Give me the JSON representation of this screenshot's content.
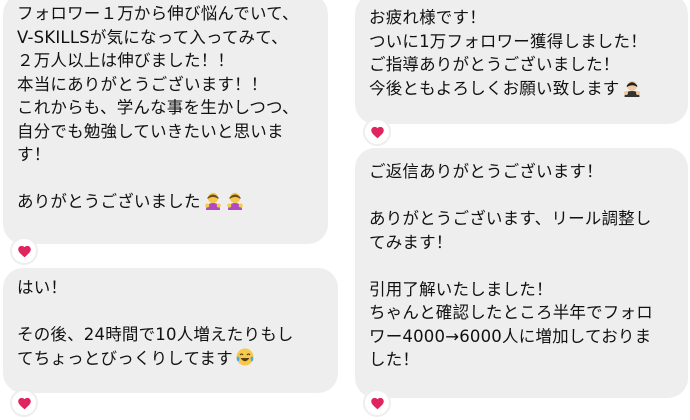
{
  "messages": [
    {
      "lines": [
        "フォロワー１万から伸び悩んでいて、",
        "V-SKILLSが気になって入ってみて、",
        "２万人以上は伸びました！！",
        "本当にありがとうございます！！",
        "これからも、学んな事を生かしつつ、",
        "自分でも勉強していきたいと思いま",
        "す！",
        "",
        "ありがとうございました"
      ],
      "reaction": "heart-icon",
      "emojis": [
        "bowing-woman-icon",
        "bowing-woman-icon"
      ]
    },
    {
      "lines": [
        "はい！",
        "",
        "その後、24時間で10人増えたりもし",
        "てちょっとびっくりしてます"
      ],
      "reaction": "heart-icon",
      "emojis": [
        "tears-of-joy-icon"
      ]
    },
    {
      "lines": [
        "お疲れ様です！",
        "ついに1万フォロワー獲得しました！",
        "ご指導ありがとうございました！",
        "今後ともよろしくお願い致します"
      ],
      "reaction": "heart-icon",
      "emojis": [
        "bowing-man-icon"
      ]
    },
    {
      "lines": [
        "ご返信ありがとうございます！",
        "",
        "ありがとうございます、リール調整し",
        "てみます！",
        "",
        "引用了解いたしました！",
        "ちゃんと確認したところ半年でフォロ",
        "ワー4000→6000人に増加しておりま",
        "した！"
      ],
      "reaction": "heart-icon",
      "emojis": []
    }
  ],
  "colors": {
    "bubble_bg": "#eeeeef",
    "text": "#111111",
    "heart": "#e0245e"
  }
}
